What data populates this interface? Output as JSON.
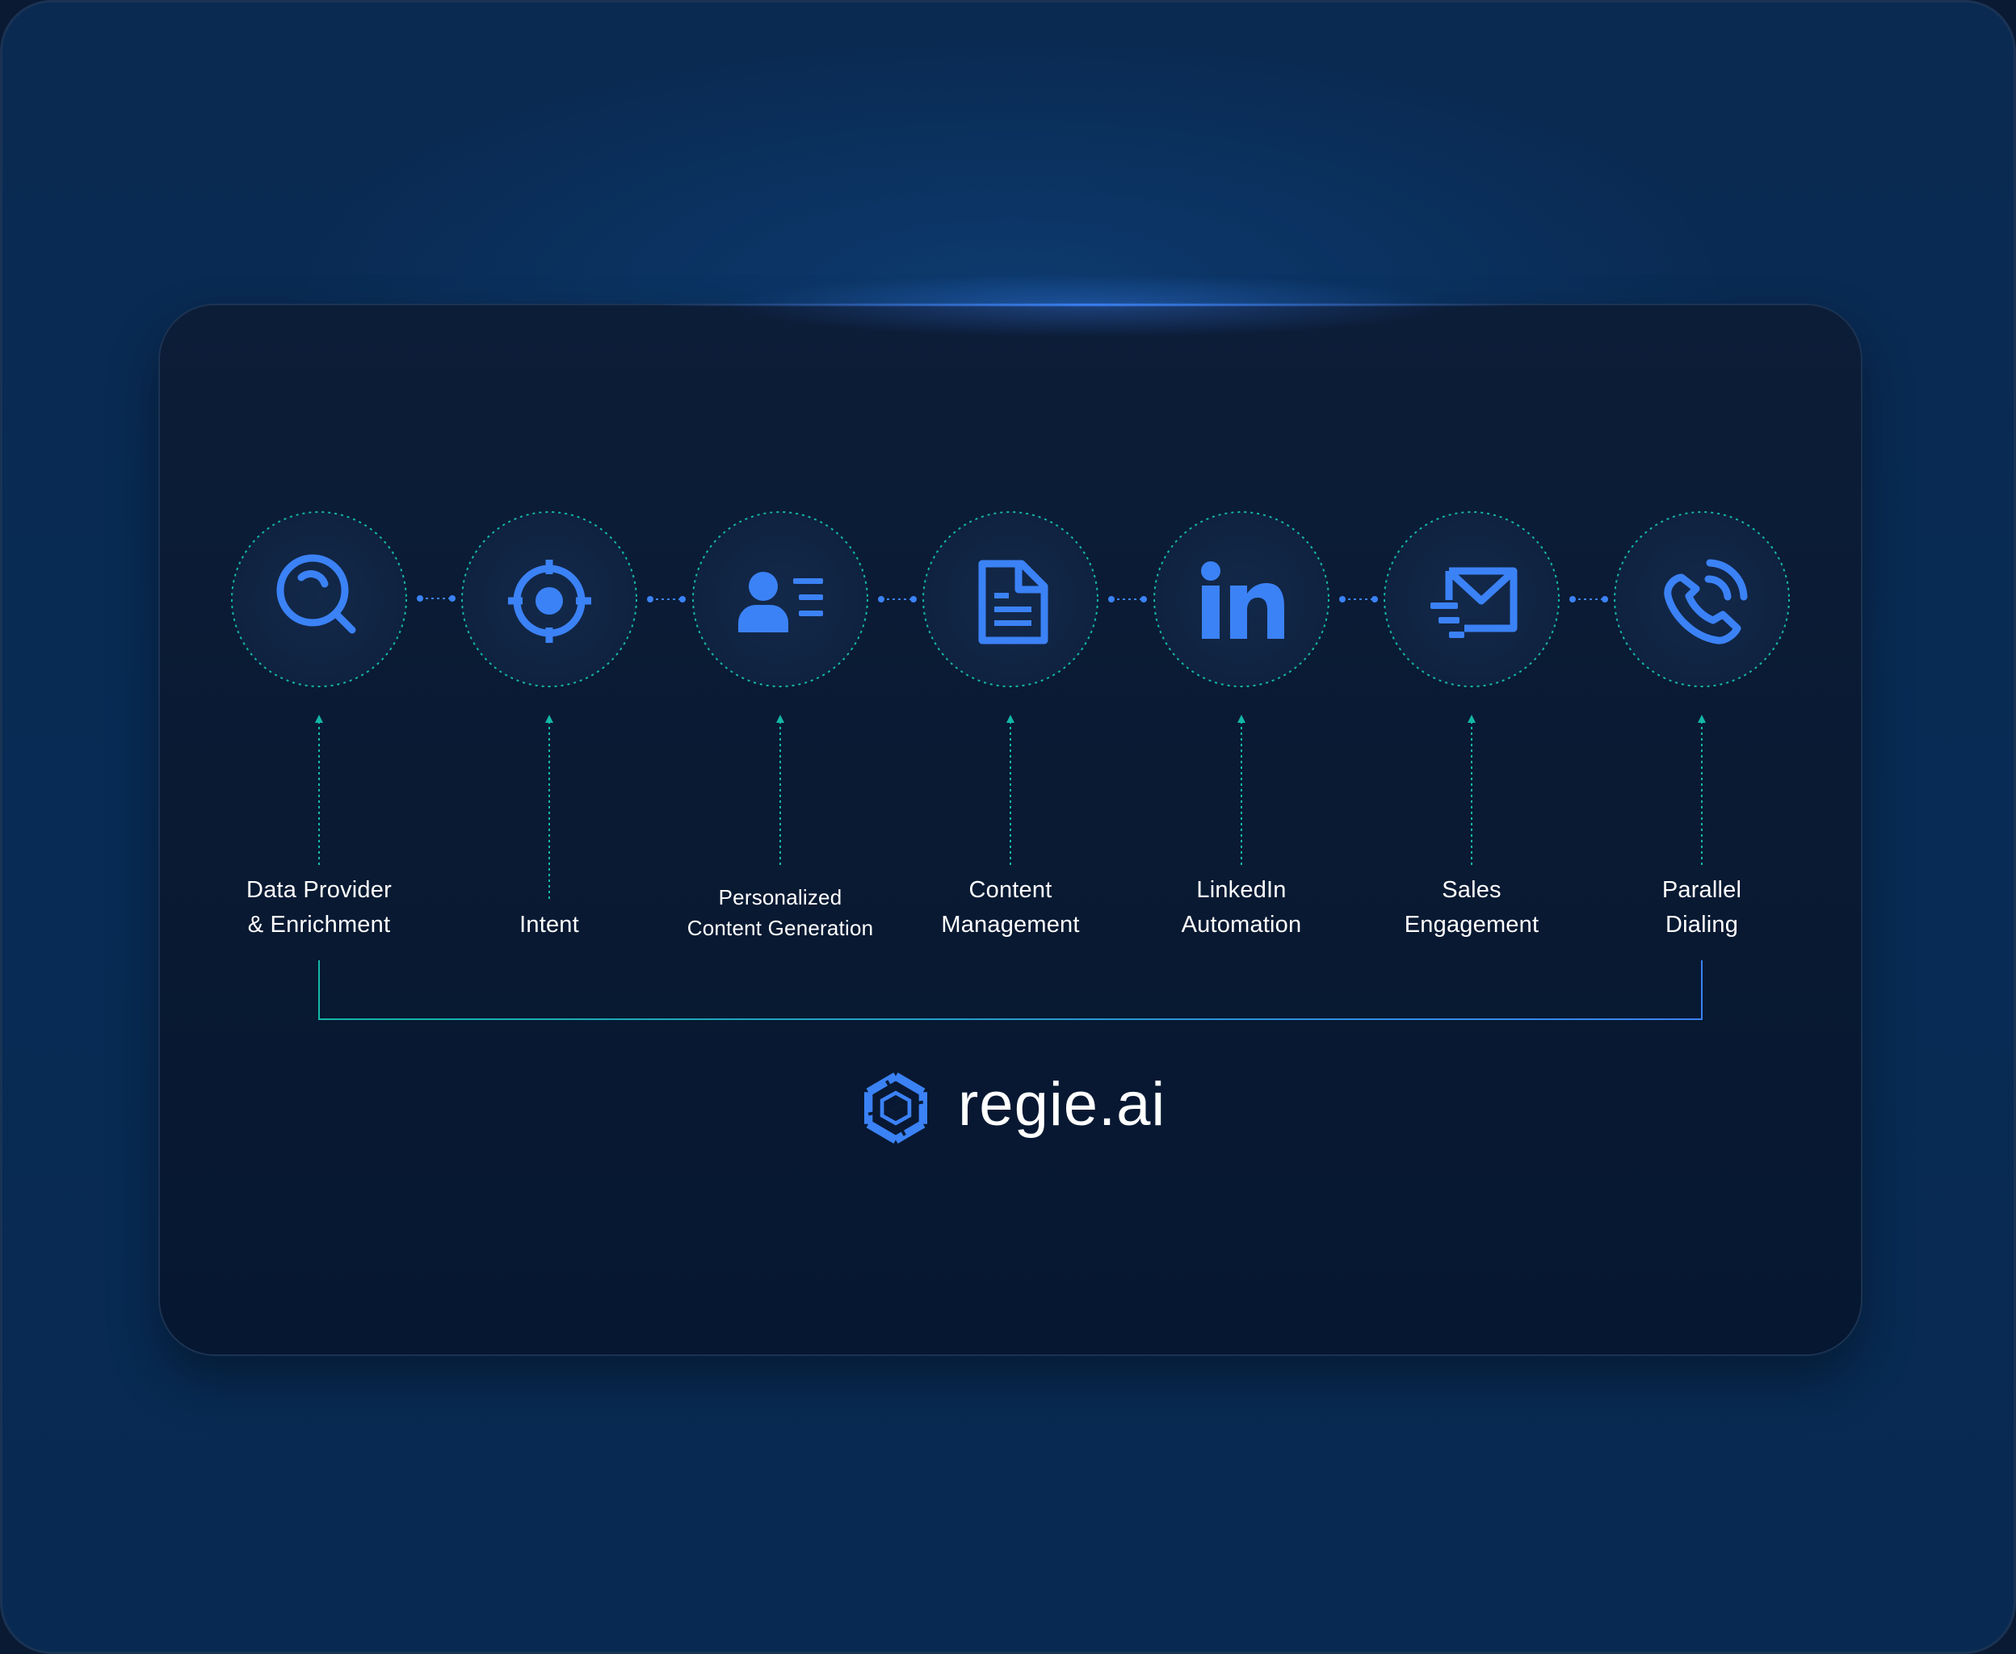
{
  "colors": {
    "accent_blue": "#3b82f6",
    "accent_teal": "#14b8a6",
    "label_text": "#ffffff",
    "card_background": "#0a1a33",
    "page_background": "#0a2a52"
  },
  "steps": [
    {
      "icon": "search-icon",
      "label_line1": "Data Provider",
      "label_line2": "& Enrichment"
    },
    {
      "icon": "crosshair-icon",
      "label_line1": "",
      "label_line2": "Intent"
    },
    {
      "icon": "contact-card-icon",
      "label_line1": "Personalized",
      "label_line2": "Content Generation"
    },
    {
      "icon": "document-icon",
      "label_line1": "Content",
      "label_line2": "Management"
    },
    {
      "icon": "linkedin-icon",
      "label_line1": "LinkedIn",
      "label_line2": "Automation"
    },
    {
      "icon": "email-fast-icon",
      "label_line1": "Sales",
      "label_line2": "Engagement"
    },
    {
      "icon": "phone-call-icon",
      "label_line1": "Parallel",
      "label_line2": "Dialing"
    }
  ],
  "brand": {
    "name": "regie.ai",
    "logo_icon": "regie-hexagon-logo-icon"
  }
}
